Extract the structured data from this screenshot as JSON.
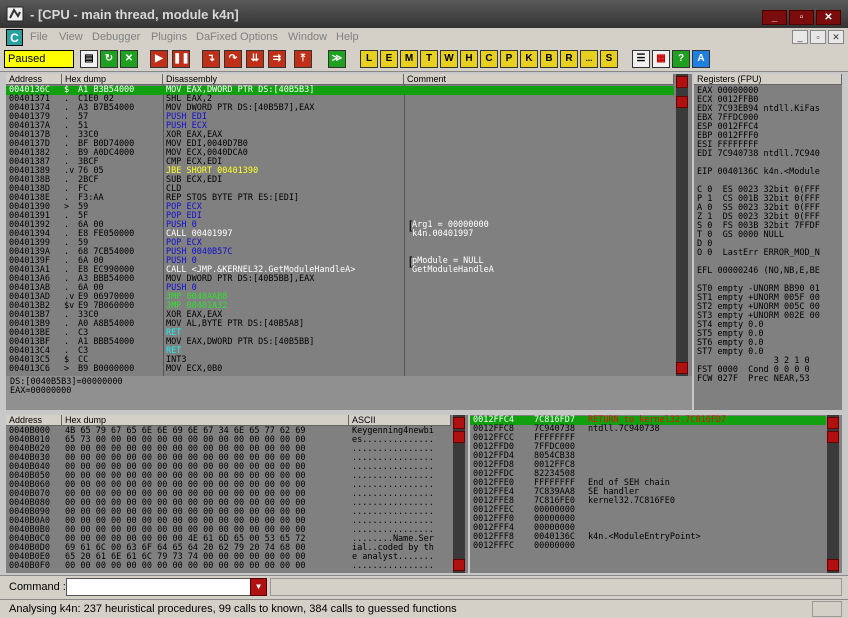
{
  "title": "- [CPU - main thread, module k4n]",
  "menu": [
    "File",
    "View",
    "Debugger",
    "Plugins",
    "DaFixed Options",
    "Window",
    "Help"
  ],
  "mdi_letter": "C",
  "status_box": "Paused",
  "toolbar_letters": [
    "L",
    "E",
    "M",
    "T",
    "W",
    "H",
    "C",
    "P",
    "K",
    "B",
    "R",
    "...",
    "S"
  ],
  "disasm": {
    "headers": [
      "Address",
      "Hex dump",
      "Disassembly",
      "Comment"
    ],
    "rows": [
      {
        "a": "0040136C",
        "m": "$",
        "h": "A1 B3B54000",
        "d": "MOV EAX,DWORD PTR DS:[40B5B3]",
        "c": "",
        "s": "hl"
      },
      {
        "a": "00401371",
        "m": ".",
        "h": "C1E0 02",
        "d": "SHL EAX,2",
        "c": "",
        "s": ""
      },
      {
        "a": "00401374",
        "m": ".",
        "h": "A3 B7B54000",
        "d": "MOV DWORD PTR DS:[40B5B7],EAX",
        "c": "",
        "s": ""
      },
      {
        "a": "00401379",
        "m": ".",
        "h": "57",
        "d": "PUSH EDI",
        "c": "",
        "s": "blue"
      },
      {
        "a": "0040137A",
        "m": ".",
        "h": "51",
        "d": "PUSH ECX",
        "c": "",
        "s": "blue"
      },
      {
        "a": "0040137B",
        "m": ".",
        "h": "33C0",
        "d": "XOR EAX,EAX",
        "c": "",
        "s": ""
      },
      {
        "a": "0040137D",
        "m": ".",
        "h": "BF B0D74000",
        "d": "MOV EDI,0040D7B0",
        "c": "",
        "s": ""
      },
      {
        "a": "00401382",
        "m": ".",
        "h": "B9 A0DC4000",
        "d": "MOV ECX,0040DCA0",
        "c": "",
        "s": ""
      },
      {
        "a": "00401387",
        "m": ".",
        "h": "3BCF",
        "d": "CMP ECX,EDI",
        "c": "",
        "s": ""
      },
      {
        "a": "00401389",
        "m": ".v",
        "h": "76 05",
        "d": "JBE SHORT 00401390",
        "c": "",
        "s": "yel"
      },
      {
        "a": "0040138B",
        "m": ".",
        "h": "2BCF",
        "d": "SUB ECX,EDI",
        "c": "",
        "s": ""
      },
      {
        "a": "0040138D",
        "m": ".",
        "h": "FC",
        "d": "CLD",
        "c": "",
        "s": ""
      },
      {
        "a": "0040138E",
        "m": ".",
        "h": "F3:AA",
        "d": "REP STOS BYTE PTR ES:[EDI]",
        "c": "",
        "s": ""
      },
      {
        "a": "00401390",
        "m": ">",
        "h": "59",
        "d": "POP ECX",
        "c": "",
        "s": "blue"
      },
      {
        "a": "00401391",
        "m": ".",
        "h": "5F",
        "d": "POP EDI",
        "c": "",
        "s": "blue"
      },
      {
        "a": "00401392",
        "m": ".",
        "h": "6A 00",
        "d": "PUSH 0",
        "c": "Arg1 = 00000000",
        "s": "blue"
      },
      {
        "a": "00401394",
        "m": ".",
        "h": "E8 FE050000",
        "d": "CALL 00401997",
        "c": "k4n.00401997",
        "s": "wht"
      },
      {
        "a": "00401399",
        "m": ".",
        "h": "59",
        "d": "POP ECX",
        "c": "",
        "s": "blue"
      },
      {
        "a": "0040139A",
        "m": ".",
        "h": "68 7CB54000",
        "d": "PUSH 0040B57C",
        "c": "",
        "s": "blue"
      },
      {
        "a": "0040139F",
        "m": ".",
        "h": "6A 00",
        "d": "PUSH 0",
        "c": "pModule = NULL",
        "s": "blue"
      },
      {
        "a": "004013A1",
        "m": ".",
        "h": "E8 EC990000",
        "d": "CALL <JMP.&KERNEL32.GetModuleHandleA>",
        "c": "GetModuleHandleA",
        "s": "wht"
      },
      {
        "a": "004013A6",
        "m": ".",
        "h": "A3 BBB54000",
        "d": "MOV DWORD PTR DS:[40B5BB],EAX",
        "c": "",
        "s": ""
      },
      {
        "a": "004013AB",
        "m": ".",
        "h": "6A 00",
        "d": "PUSH 0",
        "c": "",
        "s": "blue"
      },
      {
        "a": "004013AD",
        "m": ".v",
        "h": "E9 06970000",
        "d": "JMP 0040AAB8",
        "c": "",
        "s": "grn"
      },
      {
        "a": "004013B2",
        "m": "$v",
        "h": "E9 7B060000",
        "d": "JMP 00401A32",
        "c": "",
        "s": "grn"
      },
      {
        "a": "004013B7",
        "m": ".",
        "h": "33C0",
        "d": "XOR EAX,EAX",
        "c": "",
        "s": ""
      },
      {
        "a": "004013B9",
        "m": ".",
        "h": "A0 A8B54000",
        "d": "MOV AL,BYTE PTR DS:[40B5A8]",
        "c": "",
        "s": ""
      },
      {
        "a": "004013BE",
        "m": ".",
        "h": "C3",
        "d": "RET",
        "c": "",
        "s": "cyn"
      },
      {
        "a": "004013BF",
        "m": ".",
        "h": "A1 BBB54000",
        "d": "MOV EAX,DWORD PTR DS:[40B5BB]",
        "c": "",
        "s": ""
      },
      {
        "a": "004013C4",
        "m": ".",
        "h": "C3",
        "d": "RET",
        "c": "",
        "s": "cyn"
      },
      {
        "a": "004013C5",
        "m": "$",
        "h": "CC",
        "d": "INT3",
        "c": "",
        "s": ""
      },
      {
        "a": "004013C6",
        "m": ">",
        "h": "B9 B0000000",
        "d": "MOV ECX,0B0",
        "c": "",
        "s": ""
      }
    ],
    "info": [
      "DS:[0040B5B3]=00000000",
      "EAX=00000000"
    ]
  },
  "registers": {
    "header": "Registers (FPU)",
    "lines": [
      "EAX 00000000",
      "ECX 0012FFB0",
      "EDX 7C93EB94 ntdll.KiFas",
      "EBX 7FFDC000",
      "ESP 0012FFC4",
      "EBP 0012FFF0",
      "ESI FFFFFFFF",
      "EDI 7C940738 ntdll.7C940",
      "",
      "EIP 0040136C k4n.<Module",
      "",
      "C 0  ES 0023 32bit 0(FFF",
      "P 1  CS 001B 32bit 0(FFF",
      "A 0  SS 0023 32bit 0(FFF",
      "Z 1  DS 0023 32bit 0(FFF",
      "S 0  FS 003B 32bit 7FFDF",
      "T 0  GS 0000 NULL",
      "D 0",
      "O 0  LastErr ERROR_MOD_N",
      "",
      "EFL 00000246 (NO,NB,E,BE",
      "",
      "ST0 empty -UNORM BB90 01",
      "ST1 empty +UNORM 005F 00",
      "ST2 empty +UNORM 005C 00",
      "ST3 empty +UNORM 002E 00",
      "ST4 empty 0.0",
      "ST5 empty 0.0",
      "ST6 empty 0.0",
      "ST7 empty 0.0",
      "               3 2 1 0",
      "FST 0000  Cond 0 0 0 0",
      "FCW 027F  Prec NEAR,53"
    ]
  },
  "dump": {
    "headers": [
      "Address",
      "Hex dump",
      "ASCII"
    ],
    "rows": [
      {
        "a": "0040B000",
        "h": "4B 65 79 67 65 6E 6E 69 6E 67 34 6E 65 77 62 69",
        "t": "Keygenning4newbi"
      },
      {
        "a": "0040B010",
        "h": "65 73 00 00 00 00 00 00 00 00 00 00 00 00 00 00",
        "t": "es.............."
      },
      {
        "a": "0040B020",
        "h": "00 00 00 00 00 00 00 00 00 00 00 00 00 00 00 00",
        "t": "................"
      },
      {
        "a": "0040B030",
        "h": "00 00 00 00 00 00 00 00 00 00 00 00 00 00 00 00",
        "t": "................"
      },
      {
        "a": "0040B040",
        "h": "00 00 00 00 00 00 00 00 00 00 00 00 00 00 00 00",
        "t": "................"
      },
      {
        "a": "0040B050",
        "h": "00 00 00 00 00 00 00 00 00 00 00 00 00 00 00 00",
        "t": "................"
      },
      {
        "a": "0040B060",
        "h": "00 00 00 00 00 00 00 00 00 00 00 00 00 00 00 00",
        "t": "................"
      },
      {
        "a": "0040B070",
        "h": "00 00 00 00 00 00 00 00 00 00 00 00 00 00 00 00",
        "t": "................"
      },
      {
        "a": "0040B080",
        "h": "00 00 00 00 00 00 00 00 00 00 00 00 00 00 00 00",
        "t": "................"
      },
      {
        "a": "0040B090",
        "h": "00 00 00 00 00 00 00 00 00 00 00 00 00 00 00 00",
        "t": "................"
      },
      {
        "a": "0040B0A0",
        "h": "00 00 00 00 00 00 00 00 00 00 00 00 00 00 00 00",
        "t": "................"
      },
      {
        "a": "0040B0B0",
        "h": "00 00 00 00 00 00 00 00 00 00 00 00 00 00 00 00",
        "t": "................"
      },
      {
        "a": "0040B0C0",
        "h": "00 00 00 00 00 00 00 00 4E 61 6D 65 00 53 65 72",
        "t": "........Name.Ser"
      },
      {
        "a": "0040B0D0",
        "h": "69 61 6C 00 63 6F 64 65 64 20 62 79 20 74 68 00",
        "t": "ial..coded by th"
      },
      {
        "a": "0040B0E0",
        "h": "65 20 61 6E 61 6C 79 73 74 00 00 00 00 00 00 00",
        "t": "e analyst......."
      },
      {
        "a": "0040B0F0",
        "h": "00 00 00 00 00 00 00 00 00 00 00 00 00 00 00 00",
        "t": "................"
      }
    ]
  },
  "stack": {
    "rows": [
      {
        "a": "0012FFC4",
        "v": "7C816FD7",
        "c": "RETURN to kernel32.7C816FD7",
        "hl": true
      },
      {
        "a": "0012FFC8",
        "v": "7C940738",
        "c": "ntdll.7C940738"
      },
      {
        "a": "0012FFCC",
        "v": "FFFFFFFF",
        "c": ""
      },
      {
        "a": "0012FFD0",
        "v": "7FFDC000",
        "c": ""
      },
      {
        "a": "0012FFD4",
        "v": "8054CB38",
        "c": ""
      },
      {
        "a": "0012FFD8",
        "v": "0012FFC8",
        "c": ""
      },
      {
        "a": "0012FFDC",
        "v": "82234508",
        "c": ""
      },
      {
        "a": "0012FFE0",
        "v": "FFFFFFFF",
        "c": "End of SEH chain"
      },
      {
        "a": "0012FFE4",
        "v": "7C839AA8",
        "c": "SE handler"
      },
      {
        "a": "0012FFE8",
        "v": "7C816FE0",
        "c": "kernel32.7C816FE0"
      },
      {
        "a": "0012FFEC",
        "v": "00000000",
        "c": ""
      },
      {
        "a": "0012FFF0",
        "v": "00000000",
        "c": ""
      },
      {
        "a": "0012FFF4",
        "v": "00000000",
        "c": ""
      },
      {
        "a": "0012FFF8",
        "v": "0040136C",
        "c": "k4n.<ModuleEntryPoint>"
      },
      {
        "a": "0012FFFC",
        "v": "00000000",
        "c": ""
      }
    ]
  },
  "command": {
    "label": "Command :",
    "value": ""
  },
  "status_text": "Analysing k4n: 237 heuristical procedures, 99 calls to known, 384 calls to guessed functions"
}
